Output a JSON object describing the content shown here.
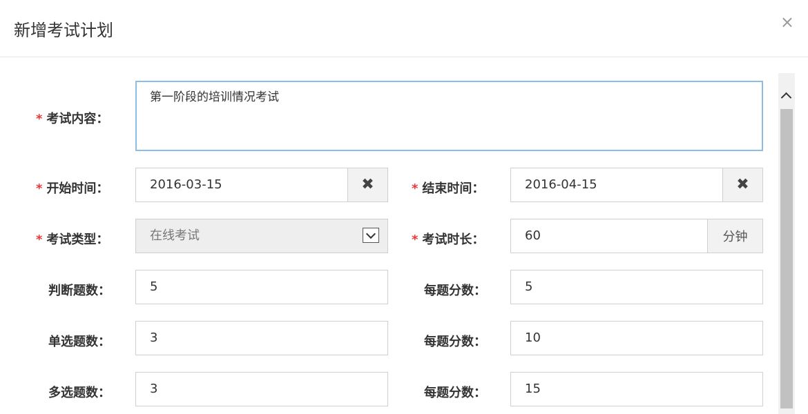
{
  "dialog": {
    "title": "新增考试计划",
    "close_symbol": "×"
  },
  "form": {
    "required_mark": "*",
    "content": {
      "label": "考试内容：",
      "value": "第一阶段的培训情况考试"
    },
    "start_time": {
      "label": "开始时间：",
      "value": "2016-03-15",
      "clear_symbol": "✖"
    },
    "end_time": {
      "label": "结束时间：",
      "value": "2016-04-15",
      "clear_symbol": "✖"
    },
    "exam_type": {
      "label": "考试类型：",
      "value": "在线考试"
    },
    "duration": {
      "label": "考试时长：",
      "value": "60",
      "unit": "分钟"
    },
    "judge_count": {
      "label": "判断题数：",
      "value": "5"
    },
    "judge_score": {
      "label": "每题分数：",
      "value": "5"
    },
    "single_count": {
      "label": "单选题数：",
      "value": "3"
    },
    "single_score": {
      "label": "每题分数：",
      "value": "10"
    },
    "multi_count": {
      "label": "多选题数：",
      "value": "3"
    },
    "multi_score": {
      "label": "每题分数：",
      "value": "15"
    }
  },
  "colors": {
    "required": "#e4393c",
    "focus_border": "#8cbde6",
    "addon_bg": "#f2f2f2"
  },
  "icons": {
    "clear": "clear-icon",
    "dropdown": "chevron-down-icon",
    "close": "close-icon"
  }
}
